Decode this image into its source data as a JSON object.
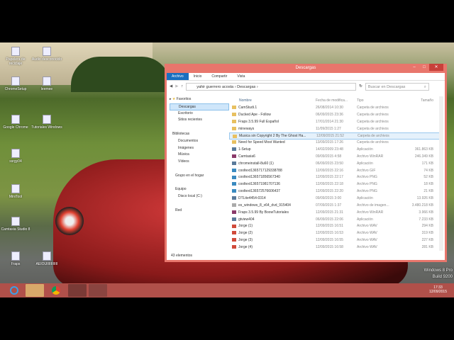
{
  "desktop": {
    "icons": [
      {
        "label": "Papelera de reciclaje"
      },
      {
        "label": "Audio desconocido"
      },
      {
        "label": "ChromeSetup"
      },
      {
        "label": "leemee"
      },
      {
        "label": "Google Chrome"
      },
      {
        "label": "Tutoriales Windows"
      },
      {
        "label": "ssrgy04"
      },
      {
        "label": "MiniTool"
      },
      {
        "label": "Camtasia Studio 8"
      },
      {
        "label": "Fraps"
      },
      {
        "label": "AEIOUIIIIIIIIIII"
      }
    ],
    "watermark": [
      "Windows 8 Pro",
      "Build 9200"
    ]
  },
  "taskbar": {
    "time": "17:33",
    "date": "12/09/2015"
  },
  "window": {
    "title": "Descargas",
    "ribbon_tabs": [
      "Archivo",
      "Inicio",
      "Compartir",
      "Vista"
    ],
    "path": [
      "yahir guerrero acosta",
      "Descargas"
    ],
    "search_placeholder": "Buscar en Descargas",
    "nav": {
      "favorites": "Favoritos",
      "fav_items": [
        "Descargas",
        "Escritorio",
        "Sitios recientes"
      ],
      "libraries": "Bibliotecas",
      "lib_items": [
        "Documentos",
        "Imágenes",
        "Música",
        "Vídeos"
      ],
      "homegroup": "Grupo en el hogar",
      "computer": "Equipo",
      "disk": "Disco local (C:)",
      "network": "Red"
    },
    "columns": [
      "Nombre",
      "Fecha de modifica...",
      "Tipo",
      "Tamaño"
    ],
    "files": [
      {
        "name": "CamStudi.1",
        "date": "26/08/2014 10:30",
        "type": "Carpeta de archivos",
        "size": "",
        "icon": "folder"
      },
      {
        "name": "Ducked Ape - Follow",
        "date": "06/09/2015 23:36",
        "type": "Carpeta de archivos",
        "size": "",
        "icon": "folder"
      },
      {
        "name": "Fraps 3.5.99 Full Español",
        "date": "17/01/2014 21:30",
        "type": "Carpeta de archivos",
        "size": "",
        "icon": "folder"
      },
      {
        "name": "mineways",
        "date": "11/09/2015 1:27",
        "type": "Carpeta de archivos",
        "size": "",
        "icon": "folder"
      },
      {
        "name": "Musica sin Copyright 2 By The Ghost Ha...",
        "date": "12/09/2015 21:52",
        "type": "Carpeta de archivos",
        "size": "",
        "icon": "folder",
        "selected": true
      },
      {
        "name": "Need for Speed Most Wanted",
        "date": "13/09/2015 17:26",
        "type": "Carpeta de archivos",
        "size": "",
        "icon": "folder"
      },
      {
        "name": "1-Setup",
        "date": "14/02/2009 23:48",
        "type": "Aplicación",
        "size": "361.863 KB",
        "icon": "app"
      },
      {
        "name": "Camtasia6",
        "date": "09/09/2015 4:58",
        "type": "Archivo WinRAR",
        "size": "246.349 KB",
        "icon": "rar"
      },
      {
        "name": "chromeinstall-8u60 (1)",
        "date": "06/09/2015 23:50",
        "type": "Aplicación",
        "size": "171 KB",
        "icon": "app"
      },
      {
        "name": "cooltext1365717129338788",
        "date": "12/09/2015 22:16",
        "type": "Archivo GIF",
        "size": "74 KB",
        "icon": "image"
      },
      {
        "name": "cooltext136571856567340",
        "date": "12/09/2015 22:17",
        "type": "Archivo PNG",
        "size": "52 KB",
        "icon": "image"
      },
      {
        "name": "cooltext136571981707136",
        "date": "12/09/2015 22:18",
        "type": "Archivo PNG",
        "size": "18 KB",
        "icon": "image"
      },
      {
        "name": "cooltext136572576606437",
        "date": "12/09/2015 22:20",
        "type": "Archivo PNG",
        "size": "21 KB",
        "icon": "image"
      },
      {
        "name": "DTLite4454-0314",
        "date": "09/09/2015 3:00",
        "type": "Aplicación",
        "size": "13.926 KB",
        "icon": "app"
      },
      {
        "name": "es_windows_8_x64_dvd_915404",
        "date": "07/09/2015 1:37",
        "type": "Archivo de imagen...",
        "size": "3.480.218 KB",
        "icon": "disc"
      },
      {
        "name": "Fraps 3.5.99 By BoowTutoriales",
        "date": "12/09/2015 21:31",
        "type": "Archivo WinRAR",
        "size": "3.966 KB",
        "icon": "rar"
      },
      {
        "name": "gtview404",
        "date": "06/09/2015 22:06",
        "type": "Aplicación",
        "size": "7.233 KB",
        "icon": "app"
      },
      {
        "name": "Jorge (1)",
        "date": "12/09/2015 16:51",
        "type": "Archivo WAV",
        "size": "294 KB",
        "icon": "audio"
      },
      {
        "name": "Jorge (2)",
        "date": "12/09/2015 16:53",
        "type": "Archivo WAV",
        "size": "319 KB",
        "icon": "audio"
      },
      {
        "name": "Jorge (3)",
        "date": "12/09/2015 16:55",
        "type": "Archivo WAV",
        "size": "227 KB",
        "icon": "audio"
      },
      {
        "name": "Jorge (4)",
        "date": "12/09/2015 16:58",
        "type": "Archivo WAV",
        "size": "281 KB",
        "icon": "audio"
      }
    ],
    "status": "43 elementos"
  },
  "colors": {
    "window_frame": "#e8766c",
    "taskbar": "#b0504a",
    "ribbon_active": "#1a6fc0"
  }
}
